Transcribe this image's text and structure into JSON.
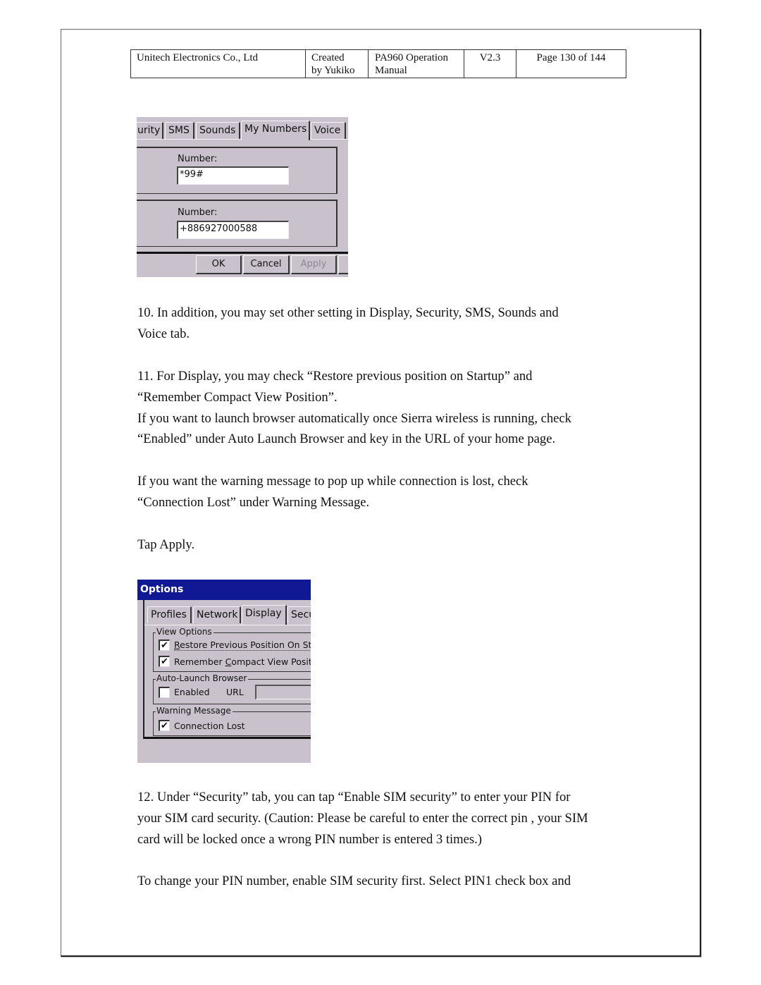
{
  "header": {
    "company": "Unitech Electronics Co., Ltd",
    "created_line1": "Created",
    "created_line2": "by Yukiko",
    "doc_line1": "PA960 Operation",
    "doc_line2": "Manual",
    "version": "V2.3",
    "page": "Page 130 of 144"
  },
  "screenshot1": {
    "tabs": [
      "urity",
      "SMS",
      "Sounds",
      "My Numbers",
      "Voice"
    ],
    "active_tab": "My Numbers",
    "group1": {
      "label": "Number:",
      "value": "*99#"
    },
    "group2": {
      "label": "Number:",
      "value": "+886927000588"
    },
    "buttons": {
      "ok": "OK",
      "cancel": "Cancel",
      "apply": "Apply"
    },
    "colors": {
      "background": "#c9c1cb"
    }
  },
  "paragraphs": {
    "p10_l1": "10. In addition, you may set other setting in Display, Security, SMS, Sounds and",
    "p10_l2": "Voice tab.",
    "p11_l1": "11. For Display, you may check “Restore previous position on Startup” and",
    "p11_l2": "“Remember Compact View Position”.",
    "p11_l3": "If you want to launch browser automatically once Sierra wireless is running, check",
    "p11_l4": "“Enabled” under Auto Launch Browser and key in the URL of your home page.",
    "p11b_l1": "If you want the warning message to pop up while connection is lost, check",
    "p11b_l2": "“Connection Lost” under Warning Message.",
    "tap_apply": "Tap Apply.",
    "p12_l1": "12. Under “Security” tab, you can tap “Enable SIM security” to enter your PIN for",
    "p12_l2": "your SIM card security. (Caution: Please be careful to enter the correct pin , your SIM",
    "p12_l3": "card will be locked once a wrong PIN number is entered 3 times.)",
    "p13_l1": "To change your PIN number, enable SIM security first. Select PIN1 check box and"
  },
  "screenshot2": {
    "title": "Options",
    "tabs": [
      "Profiles",
      "Network",
      "Display",
      "Secu"
    ],
    "active_tab": "Display",
    "view_options": {
      "legend": "View Options",
      "items": [
        {
          "label_pre": "",
          "label_u": "R",
          "label_post": "estore Previous Position On St",
          "checked": true
        },
        {
          "label_pre": "Remember ",
          "label_u": "C",
          "label_post": "ompact View Positic",
          "checked": true
        }
      ]
    },
    "auto_launch": {
      "legend": "Auto-Launch Browser",
      "enabled_label": "Enabled",
      "enabled_checked": false,
      "url_label": "URL",
      "url_value": ""
    },
    "warning": {
      "legend": "Warning Message",
      "label": "Connection Lost",
      "checked": true
    },
    "colors": {
      "titlebar": "#101894",
      "background": "#c9c1cb"
    }
  },
  "icons": {
    "check": "✔"
  }
}
